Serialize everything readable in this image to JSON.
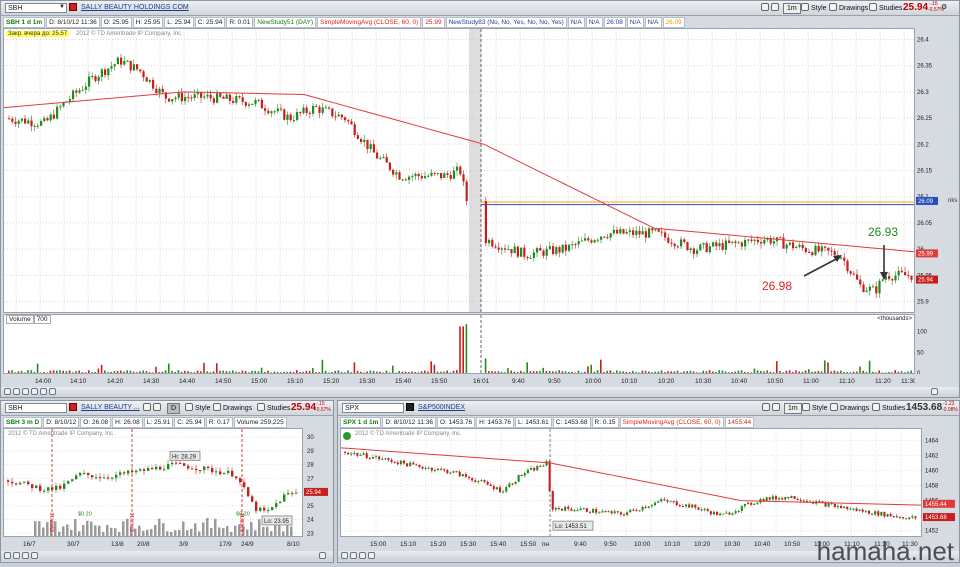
{
  "main": {
    "symbol": "SBH",
    "description": "SALLY BEAUTY HOLDINGS COM",
    "tool_1m": "1m",
    "style": "Style",
    "drawings": "Drawings",
    "studies": "Studies",
    "last": "25.94",
    "change_top": "-.15",
    "change_bot": "-0.57%",
    "info": {
      "title": "SBH 1 d 1m",
      "d": "D: 8/10/12 11:36",
      "o": "O: 25.95",
      "h": "H: 25.95",
      "l": "L: 25.94",
      "c": "C: 25.94",
      "r": "R: 0.01",
      "ns1": "NewStudy51 (DAY)",
      "sma": "SimpleMovingAvg (CLOSE, 60, 0)",
      "sma_val": "25.99",
      "ns83": "NewStudy83 (No, No, Yes, No, No, Yes)",
      "na1": "N/A",
      "na2": "N/A",
      "v1": "26.08",
      "na3": "N/A",
      "na4": "N/A",
      "v2": "26.09"
    },
    "yellow_label": "Закр. вчера до: 25.57",
    "copyright": "2012 © TD Ameritrade IP Company, Inc.",
    "price_ticks": [
      "26.4",
      "26.35",
      "26.3",
      "26.25",
      "26.2",
      "26.15",
      "26.1",
      "26.05",
      "26",
      "25.95",
      "25.9"
    ],
    "tag_blue": "26.09",
    "tag_red1": "25.99",
    "tag_red2": "25.94",
    "side_text": "nks",
    "annot_a": "26.98",
    "annot_b": "26.93",
    "volume_label": "Volume",
    "volume_val": "700",
    "thousands": "<thousands>",
    "vol_ticks": [
      "100",
      "50",
      "0"
    ],
    "time_labels": [
      "14:00",
      "14:10",
      "14:20",
      "14:30",
      "14:40",
      "14:50",
      "15:00",
      "15:10",
      "15:20",
      "15:30",
      "15:40",
      "15:50",
      "16:01",
      "9:40",
      "9:50",
      "10:00",
      "10:10",
      "10:20",
      "10:30",
      "10:40",
      "10:50",
      "11:00",
      "11:10",
      "11:20",
      "11:30"
    ]
  },
  "left": {
    "symbol": "SBH",
    "description": "SALLY BEAUTY ...",
    "d_btn": "D",
    "style": "Style",
    "drawings": "Drawings",
    "studies": "Studies",
    "last": "25.94",
    "change_top": "-.15",
    "change_bot": "-0.57%",
    "info": {
      "title": "SBH 3 m D",
      "d": "D: 8/10/12",
      "o": "O: 26.08",
      "h": "H: 26.08",
      "l": "L: 25.91",
      "c": "C: 25.94",
      "r": "R: 0.17",
      "vol": "Volume 259,225"
    },
    "copyright": "2012 © TD Ameritrade IP Company, Inc.",
    "hi": "Hi: 28.29",
    "lo": "Lo: 23.95",
    "tag": "25.94",
    "price_ticks": [
      "30",
      "29",
      "28",
      "27",
      "26",
      "25",
      "24",
      "23"
    ],
    "event_dates": [
      "29/07/12",
      "17/07/12",
      "17/08/12"
    ],
    "div_labels": [
      "$0.20",
      "$0.20"
    ],
    "time_labels": [
      "16/7",
      "30/7",
      "13/8",
      "20/8",
      "3/9",
      "17/9",
      "24/9",
      "8/10"
    ]
  },
  "right": {
    "symbol": "SPX",
    "description": "S&P500INDEX",
    "tool_1m": "1m",
    "style": "Style",
    "drawings": "Drawings",
    "studies": "Studies",
    "last": "1453.68",
    "change_top": "-1.23",
    "change_bot": "-0.08%",
    "info": {
      "title": "SPX 1 d 1m",
      "d": "D: 8/10/12 11:36",
      "o": "O: 1453.76",
      "h": "H: 1453.76",
      "l": "L: 1453.61",
      "c": "C: 1453.68",
      "r": "R: 0.15",
      "sma": "SimpleMovingAvg (CLOSE, 60, 0)",
      "sma_val": "1455.44"
    },
    "copyright": "2012 © TD Ameritrade IP Company, Inc.",
    "lo": "Lo: 1453.51",
    "price_ticks": [
      "1464",
      "1462",
      "1460",
      "1458",
      "1456",
      "1454",
      "1452"
    ],
    "tag_sma": "1455.44",
    "tag_last": "1453.68",
    "time_labels": [
      "15:00",
      "15:10",
      "15:20",
      "15:30",
      "15:40",
      "15:50",
      "пн",
      "9:40",
      "9:50",
      "10:00",
      "10:10",
      "10:20",
      "10:30",
      "10:40",
      "10:50",
      "11:00",
      "11:10",
      "11:20",
      "11:30"
    ]
  },
  "watermark": "hamaha.net"
}
